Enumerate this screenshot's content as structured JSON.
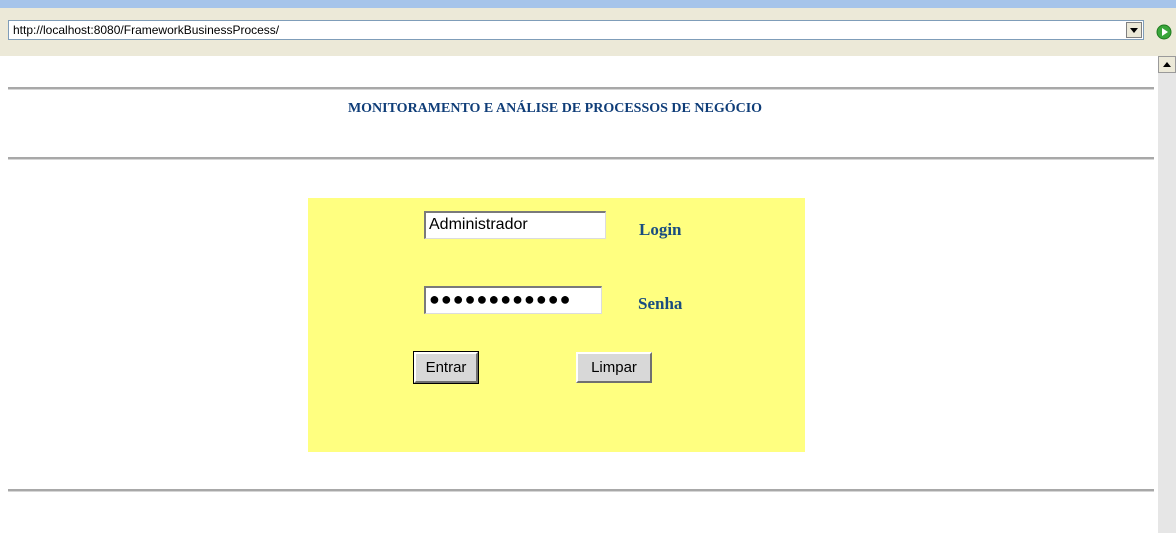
{
  "browser": {
    "url": "http://localhost:8080/FrameworkBusinessProcess/"
  },
  "page": {
    "title": "MONITORAMENTO E ANÁLISE DE PROCESSOS DE NEGÓCIO"
  },
  "login_form": {
    "login_value": "Administrador",
    "login_label": "Login",
    "password_value": "●●●●●●●●●●●●",
    "password_label": "Senha",
    "submit_label": "Entrar",
    "clear_label": "Limpar"
  },
  "colors": {
    "panel_background": "#ffff80",
    "title_color": "#0f3d78",
    "label_color": "#1a4d80"
  },
  "icons": {
    "dropdown": "chevron-down-icon",
    "go": "go-arrow-icon",
    "scroll_up": "scroll-up-arrow-icon"
  }
}
